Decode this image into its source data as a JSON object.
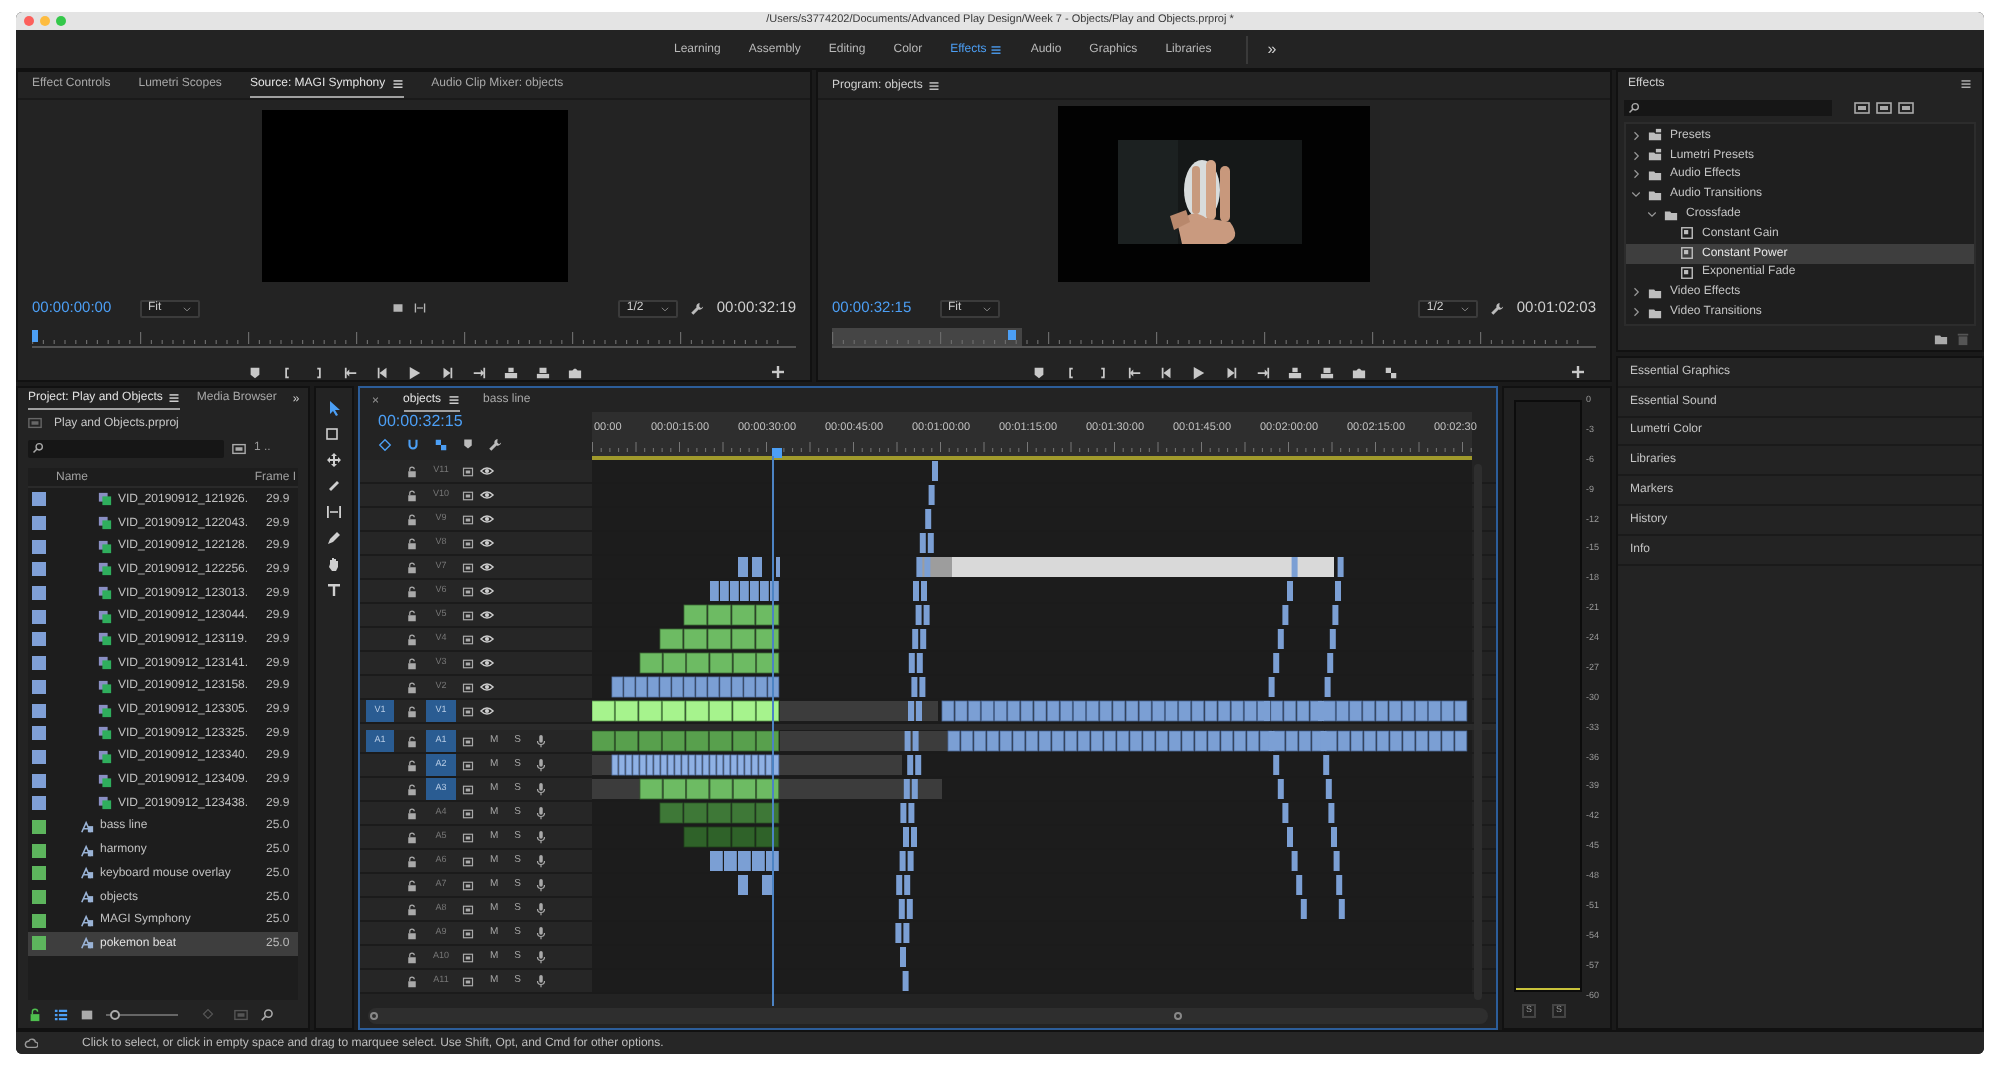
{
  "window": {
    "title": "/Users/s3774202/Documents/Advanced Play Design/Week 7 - Objects/Play and Objects.prproj *"
  },
  "workspaces": [
    {
      "label": "Learning",
      "selected": false
    },
    {
      "label": "Assembly",
      "selected": false
    },
    {
      "label": "Editing",
      "selected": false
    },
    {
      "label": "Color",
      "selected": false
    },
    {
      "label": "Effects",
      "selected": true
    },
    {
      "label": "Audio",
      "selected": false
    },
    {
      "label": "Graphics",
      "selected": false
    },
    {
      "label": "Libraries",
      "selected": false
    }
  ],
  "workspace_overflow": "»",
  "source_panel": {
    "tabs": [
      {
        "label": "Effect Controls",
        "selected": false
      },
      {
        "label": "Lumetri Scopes",
        "selected": false
      },
      {
        "label": "Source: MAGI Symphony",
        "selected": true
      },
      {
        "label": "Audio Clip Mixer: objects",
        "selected": false
      }
    ],
    "timecode": "00:00:00:00",
    "zoom": "Fit",
    "resolution": "1/2",
    "duration": "00:00:32:19"
  },
  "program_panel": {
    "title": "Program: objects",
    "timecode": "00:00:32:15",
    "zoom": "Fit",
    "resolution": "1/2",
    "duration": "00:01:02:03"
  },
  "effects_panel": {
    "title": "Effects",
    "tree": [
      {
        "label": "Presets",
        "kind": "preset-folder",
        "expanded": false,
        "selected": false
      },
      {
        "label": "Lumetri Presets",
        "kind": "preset-folder",
        "expanded": false,
        "selected": false
      },
      {
        "label": "Audio Effects",
        "kind": "folder",
        "expanded": false,
        "selected": false
      },
      {
        "label": "Audio Transitions",
        "kind": "folder",
        "expanded": true,
        "selected": false,
        "children": [
          {
            "label": "Crossfade",
            "kind": "folder",
            "expanded": true,
            "selected": false,
            "children": [
              {
                "label": "Constant Gain",
                "kind": "effect",
                "selected": false
              },
              {
                "label": "Constant Power",
                "kind": "effect",
                "selected": true
              },
              {
                "label": "Exponential Fade",
                "kind": "effect",
                "selected": false
              }
            ]
          }
        ]
      },
      {
        "label": "Video Effects",
        "kind": "folder",
        "expanded": false,
        "selected": false
      },
      {
        "label": "Video Transitions",
        "kind": "folder",
        "expanded": false,
        "selected": false
      }
    ]
  },
  "side_panels": [
    "Essential Graphics",
    "Essential Sound",
    "Lumetri Color",
    "Libraries",
    "Markers",
    "History",
    "Info"
  ],
  "project_panel": {
    "tabs": [
      {
        "label": "Project: Play and Objects",
        "selected": true
      },
      {
        "label": "Media Browser",
        "selected": false
      }
    ],
    "overflow": "»",
    "path": "Play and Objects.prproj",
    "item_count": "1 ..",
    "columns": [
      "Name",
      "Frame I"
    ],
    "zoom_slider": {
      "level": 0.05
    },
    "items": [
      {
        "name": "VID_20190912_121926.",
        "frame_rate": "29.9",
        "kind": "clip",
        "color": "#7f9fd6",
        "selected": false
      },
      {
        "name": "VID_20190912_122043.",
        "frame_rate": "29.9",
        "kind": "clip",
        "color": "#7f9fd6",
        "selected": false
      },
      {
        "name": "VID_20190912_122128.",
        "frame_rate": "29.9",
        "kind": "clip",
        "color": "#7f9fd6",
        "selected": false
      },
      {
        "name": "VID_20190912_122256.",
        "frame_rate": "29.9",
        "kind": "clip",
        "color": "#7f9fd6",
        "selected": false
      },
      {
        "name": "VID_20190912_123013.",
        "frame_rate": "29.9",
        "kind": "clip",
        "color": "#7f9fd6",
        "selected": false
      },
      {
        "name": "VID_20190912_123044.",
        "frame_rate": "29.9",
        "kind": "clip",
        "color": "#7f9fd6",
        "selected": false
      },
      {
        "name": "VID_20190912_123119.",
        "frame_rate": "29.9",
        "kind": "clip",
        "color": "#7f9fd6",
        "selected": false
      },
      {
        "name": "VID_20190912_123141.",
        "frame_rate": "29.9",
        "kind": "clip",
        "color": "#7f9fd6",
        "selected": false
      },
      {
        "name": "VID_20190912_123158.",
        "frame_rate": "29.9",
        "kind": "clip",
        "color": "#7f9fd6",
        "selected": false
      },
      {
        "name": "VID_20190912_123305.",
        "frame_rate": "29.9",
        "kind": "clip",
        "color": "#7f9fd6",
        "selected": false
      },
      {
        "name": "VID_20190912_123325.",
        "frame_rate": "29.9",
        "kind": "clip",
        "color": "#7f9fd6",
        "selected": false
      },
      {
        "name": "VID_20190912_123340.",
        "frame_rate": "29.9",
        "kind": "clip",
        "color": "#7f9fd6",
        "selected": false
      },
      {
        "name": "VID_20190912_123409.",
        "frame_rate": "29.9",
        "kind": "clip",
        "color": "#7f9fd6",
        "selected": false
      },
      {
        "name": "VID_20190912_123438.",
        "frame_rate": "29.9",
        "kind": "clip",
        "color": "#7f9fd6",
        "selected": false
      },
      {
        "name": "bass line",
        "frame_rate": "25.0",
        "kind": "sequence",
        "color": "#5db55d",
        "selected": false
      },
      {
        "name": "harmony",
        "frame_rate": "25.0",
        "kind": "sequence",
        "color": "#5db55d",
        "selected": false
      },
      {
        "name": "keyboard mouse overlay",
        "frame_rate": "25.0",
        "kind": "sequence",
        "color": "#5db55d",
        "selected": false
      },
      {
        "name": "objects",
        "frame_rate": "25.0",
        "kind": "sequence",
        "color": "#5db55d",
        "selected": false
      },
      {
        "name": "MAGI Symphony",
        "frame_rate": "25.0",
        "kind": "sequence",
        "color": "#5db55d",
        "selected": false
      },
      {
        "name": "pokemon beat",
        "frame_rate": "25.0",
        "kind": "sequence",
        "color": "#5db55d",
        "selected": true
      }
    ]
  },
  "timeline": {
    "close": "×",
    "tabs": [
      {
        "label": "objects",
        "selected": true
      },
      {
        "label": "bass line",
        "selected": false
      }
    ],
    "timecode": "00:00:32:15",
    "ruler": [
      "00:00",
      "00:00:15:00",
      "00:00:30:00",
      "00:00:45:00",
      "00:01:00:00",
      "00:01:15:00",
      "00:01:30:00",
      "00:01:45:00",
      "00:02:00:00",
      "00:02:15:00",
      "00:02:30"
    ],
    "video_tracks": [
      {
        "name": "V11",
        "targeted": false
      },
      {
        "name": "V10",
        "targeted": false
      },
      {
        "name": "V9",
        "targeted": false
      },
      {
        "name": "V8",
        "targeted": false
      },
      {
        "name": "V7",
        "targeted": false
      },
      {
        "name": "V6",
        "targeted": false
      },
      {
        "name": "V5",
        "targeted": false
      },
      {
        "name": "V4",
        "targeted": false
      },
      {
        "name": "V3",
        "targeted": false
      },
      {
        "name": "V2",
        "targeted": false
      },
      {
        "name": "V1",
        "targeted": true,
        "source_patch": "V1"
      }
    ],
    "audio_tracks": [
      {
        "name": "A1",
        "targeted": true,
        "source_patch": "A1",
        "mute": "M",
        "solo": "S"
      },
      {
        "name": "A2",
        "targeted": true,
        "mute": "M",
        "solo": "S"
      },
      {
        "name": "A3",
        "targeted": true,
        "mute": "M",
        "solo": "S"
      },
      {
        "name": "A4",
        "targeted": false,
        "mute": "M",
        "solo": "S"
      },
      {
        "name": "A5",
        "targeted": false,
        "mute": "M",
        "solo": "S"
      },
      {
        "name": "A6",
        "targeted": false,
        "mute": "M",
        "solo": "S"
      },
      {
        "name": "A7",
        "targeted": false,
        "mute": "M",
        "solo": "S"
      },
      {
        "name": "A8",
        "targeted": false,
        "mute": "M",
        "solo": "S"
      },
      {
        "name": "A9",
        "targeted": false,
        "mute": "M",
        "solo": "S"
      },
      {
        "name": "A10",
        "targeted": false,
        "mute": "M",
        "solo": "S"
      },
      {
        "name": "A11",
        "targeted": false,
        "mute": "M",
        "solo": "S"
      }
    ]
  },
  "audio_meter": {
    "scale": [
      "0",
      "-3",
      "-6",
      "-9",
      "-12",
      "-15",
      "-18",
      "-21",
      "-24",
      "-27",
      "-30",
      "-33",
      "-36",
      "-39",
      "-42",
      "-45",
      "-48",
      "-51",
      "-54",
      "-57",
      "-60"
    ],
    "solo_buttons": [
      "S",
      "S"
    ]
  },
  "status_bar": "Click to select, or click in empty space and drag to marquee select. Use Shift, Opt, and Cmd for other options."
}
